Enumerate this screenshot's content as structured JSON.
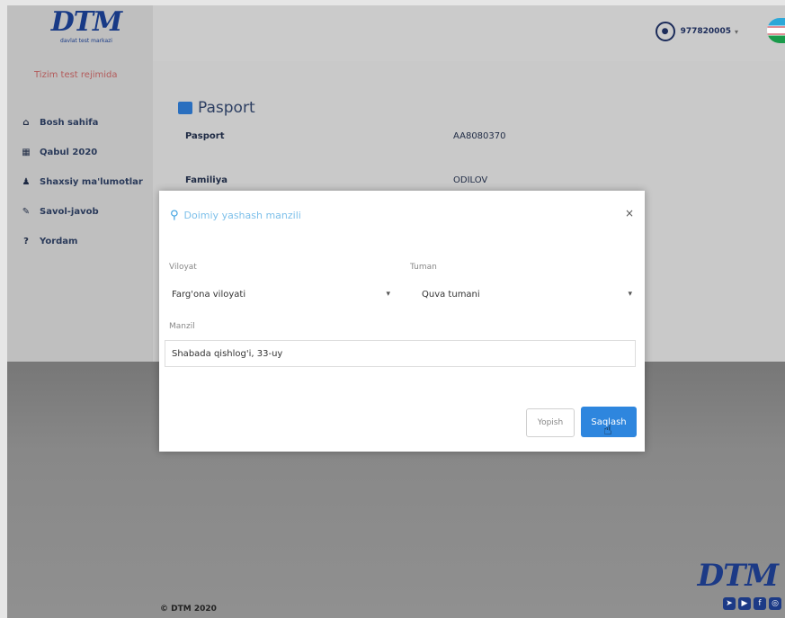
{
  "brand": {
    "logo_text": "DTM",
    "logo_subtext": "davlat test markazi",
    "subtitle": "Tizim test rejimida"
  },
  "sidebar": {
    "items": [
      {
        "label": "Bosh sahifa",
        "icon": "home-icon"
      },
      {
        "label": "Qabul 2020",
        "icon": "calendar-icon"
      },
      {
        "label": "Shaxsiy ma'lumotlar",
        "icon": "user-icon"
      },
      {
        "label": "Savol-javob",
        "icon": "chat-icon"
      },
      {
        "label": "Yordam",
        "icon": "help-icon"
      }
    ]
  },
  "header": {
    "user_name": "977820005"
  },
  "passport_section": {
    "title": "Pasport",
    "rows": [
      {
        "label": "Pasport",
        "value": "AA8080370"
      },
      {
        "label": "Familiya",
        "value": "ODILOV"
      }
    ]
  },
  "modal": {
    "title": "Doimiy yashash manzili",
    "close_symbol": "×",
    "region": {
      "label": "Viloyat",
      "value": "Farg'ona viloyati"
    },
    "district": {
      "label": "Tuman",
      "value": "Quva tumani"
    },
    "address": {
      "label": "Manzil",
      "value": "Shabada qishlog'i, 33-uy"
    },
    "close_button": "Yopish",
    "save_button": "Saqlash"
  },
  "footer": {
    "copyright": "© DTM 2020",
    "logo_text": "DTM"
  },
  "colors": {
    "accent": "#2e86de",
    "brand": "#183a86"
  }
}
